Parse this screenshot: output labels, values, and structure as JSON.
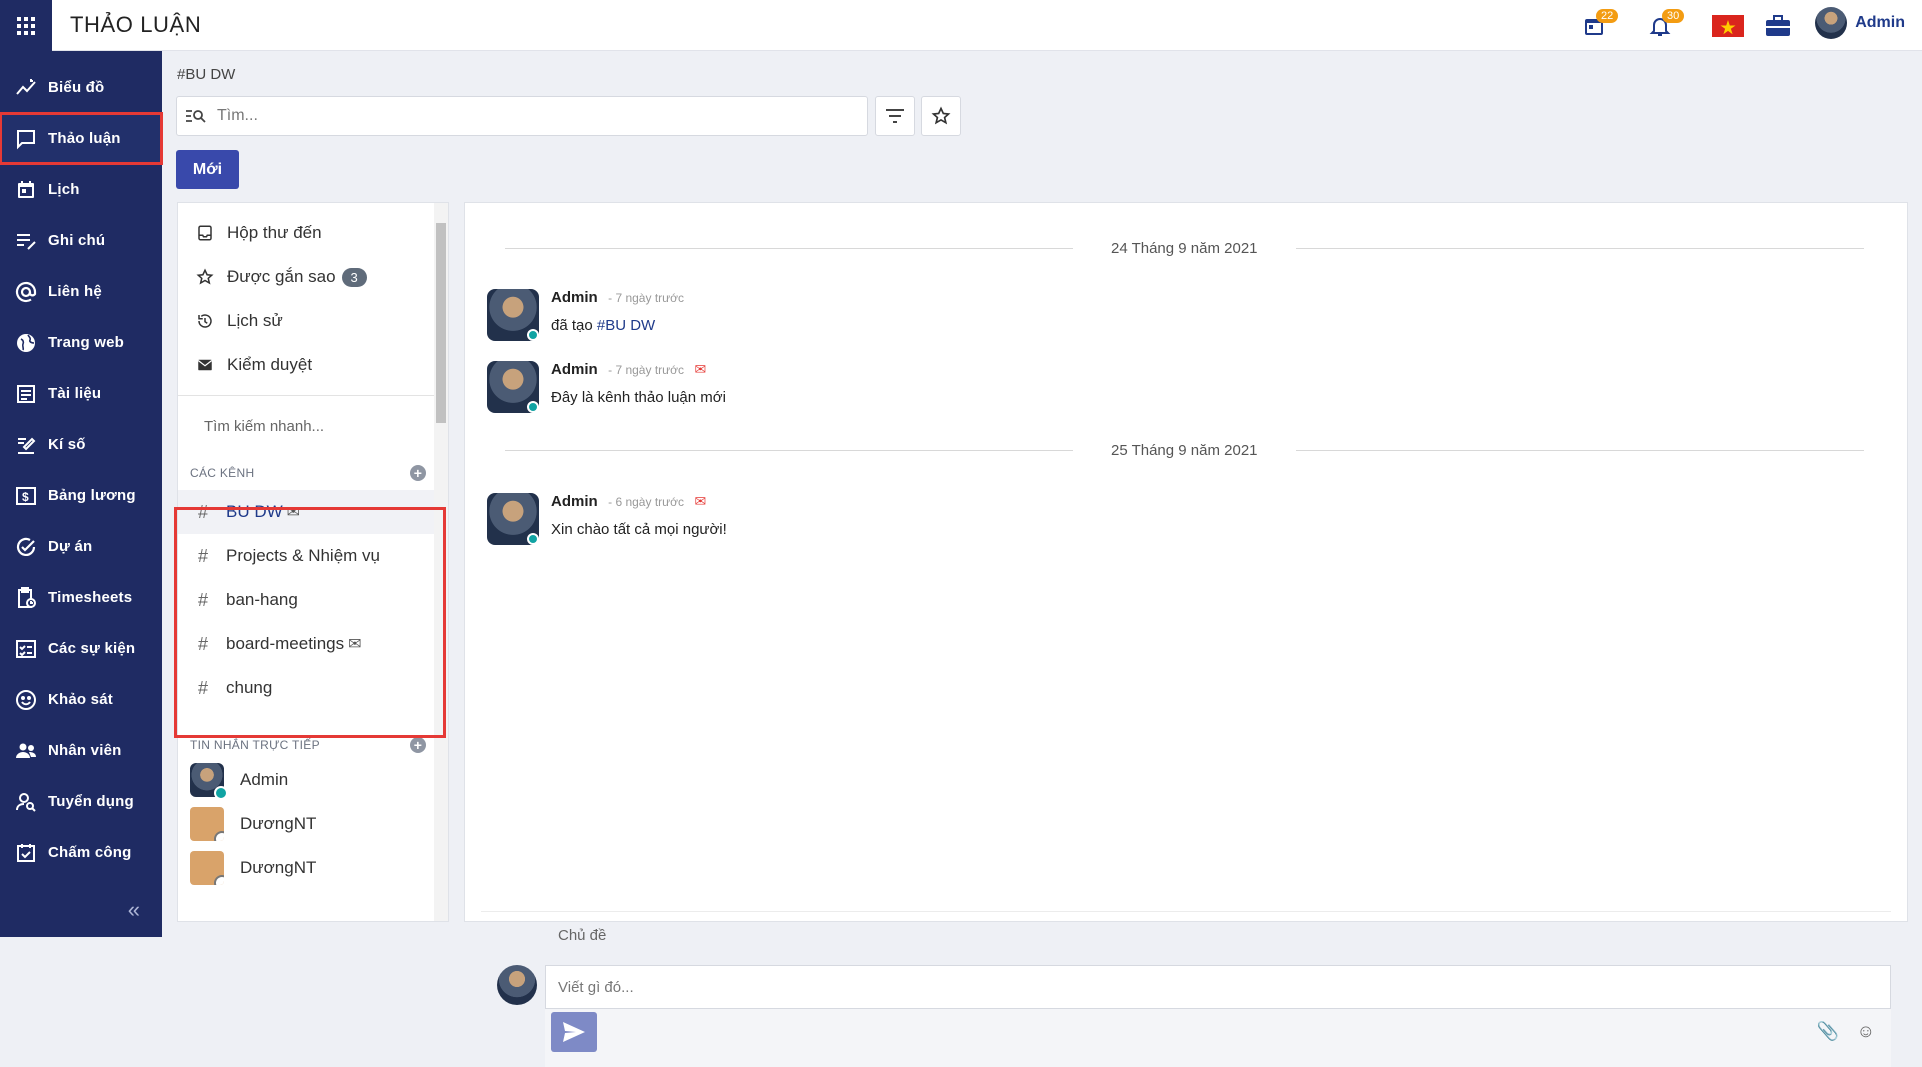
{
  "app": {
    "title": "THẢO LUẬN"
  },
  "topbar": {
    "calendar_count": "22",
    "notif_count": "30",
    "user_name": "Admin"
  },
  "sidebar_nav": {
    "items": [
      {
        "label": "Biểu đồ",
        "icon": "chart-icon"
      },
      {
        "label": "Thảo luận",
        "icon": "chat-icon"
      },
      {
        "label": "Lịch",
        "icon": "calendar-icon"
      },
      {
        "label": "Ghi chú",
        "icon": "note-icon"
      },
      {
        "label": "Liên hệ",
        "icon": "at-icon"
      },
      {
        "label": "Trang web",
        "icon": "globe-icon"
      },
      {
        "label": "Tài liệu",
        "icon": "document-icon"
      },
      {
        "label": "Kí số",
        "icon": "sign-icon"
      },
      {
        "label": "Bảng lương",
        "icon": "payroll-icon"
      },
      {
        "label": "Dự án",
        "icon": "check-circle-icon"
      },
      {
        "label": "Timesheets",
        "icon": "clipboard-clock-icon"
      },
      {
        "label": "Các sự kiện",
        "icon": "event-icon"
      },
      {
        "label": "Khảo sát",
        "icon": "smile-icon"
      },
      {
        "label": "Nhân viên",
        "icon": "people-icon"
      },
      {
        "label": "Tuyển dụng",
        "icon": "person-search-icon"
      },
      {
        "label": "Chấm công",
        "icon": "checkbox-calendar-icon"
      }
    ]
  },
  "control": {
    "breadcrumb": "#BU DW",
    "search_placeholder": "Tìm...",
    "new_label": "Mới"
  },
  "mailboxes": [
    {
      "label": "Hộp thư đến",
      "icon": "inbox-icon"
    },
    {
      "label": "Được gắn sao",
      "icon": "star-icon",
      "count": "3"
    },
    {
      "label": "Lịch sử",
      "icon": "history-icon"
    },
    {
      "label": "Kiểm duyệt",
      "icon": "envelope-icon"
    }
  ],
  "quick_search_placeholder": "Tìm kiếm nhanh...",
  "channels_header": "CÁC KÊNH",
  "channels": [
    {
      "name": "BU DW",
      "has_mail": true
    },
    {
      "name": "Projects & Nhiệm vụ",
      "has_mail": false
    },
    {
      "name": "ban-hang",
      "has_mail": false
    },
    {
      "name": "board-meetings",
      "has_mail": true
    },
    {
      "name": "chung",
      "has_mail": false
    }
  ],
  "dm_header": "TIN NHẮN TRỰC TIẾP",
  "direct_messages": [
    {
      "name": "Admin",
      "online": true
    },
    {
      "name": "DươngNT",
      "online": false
    },
    {
      "name": "DươngNT",
      "online": false
    }
  ],
  "thread": {
    "date1": "24 Tháng 9 năm 2021",
    "date2": "25 Tháng 9 năm 2021",
    "messages": [
      {
        "author": "Admin",
        "time": "- 7 ngày trước",
        "text": "đã tạo ",
        "link": "#BU DW"
      },
      {
        "author": "Admin",
        "time": "- 7 ngày trước",
        "text": "Đây là kênh thảo luận mới"
      },
      {
        "author": "Admin",
        "time": "- 6 ngày trước",
        "text": "Xin chào tất cả mọi người!"
      }
    ],
    "subject_placeholder": "Chủ đề",
    "composer_placeholder": "Viết gì đó..."
  },
  "colors": {
    "rail": "#1f2b63",
    "accent": "#3949ab",
    "highlight": "#e53935",
    "badge": "#f39c12"
  }
}
